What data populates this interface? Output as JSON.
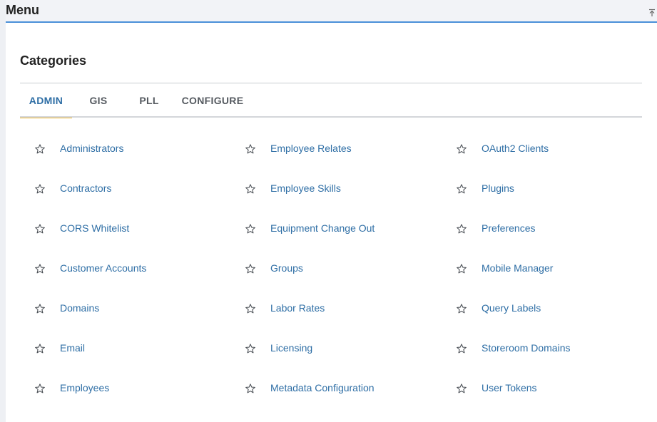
{
  "menu": {
    "title": "Menu",
    "collapse_icon": "collapse-up-icon"
  },
  "categories": {
    "title": "Categories",
    "tabs": [
      {
        "label": "ADMIN",
        "active": true
      },
      {
        "label": "GIS",
        "active": false
      },
      {
        "label": "PLL",
        "active": false
      },
      {
        "label": "CONFIGURE",
        "active": false
      }
    ],
    "star_icon": "star-outline-icon",
    "colors": {
      "link": "#2e6ea5",
      "active_tab_underline": "#f0b72f",
      "header_border": "#4a90d9"
    },
    "columns": [
      [
        "Administrators",
        "Contractors",
        "CORS Whitelist",
        "Customer Accounts",
        "Domains",
        "Email",
        "Employees"
      ],
      [
        "Employee Relates",
        "Employee Skills",
        "Equipment Change Out",
        "Groups",
        "Labor Rates",
        "Licensing",
        "Metadata Configuration"
      ],
      [
        "OAuth2 Clients",
        "Plugins",
        "Preferences",
        "Mobile Manager",
        "Query Labels",
        "Storeroom Domains",
        "User Tokens"
      ]
    ]
  }
}
